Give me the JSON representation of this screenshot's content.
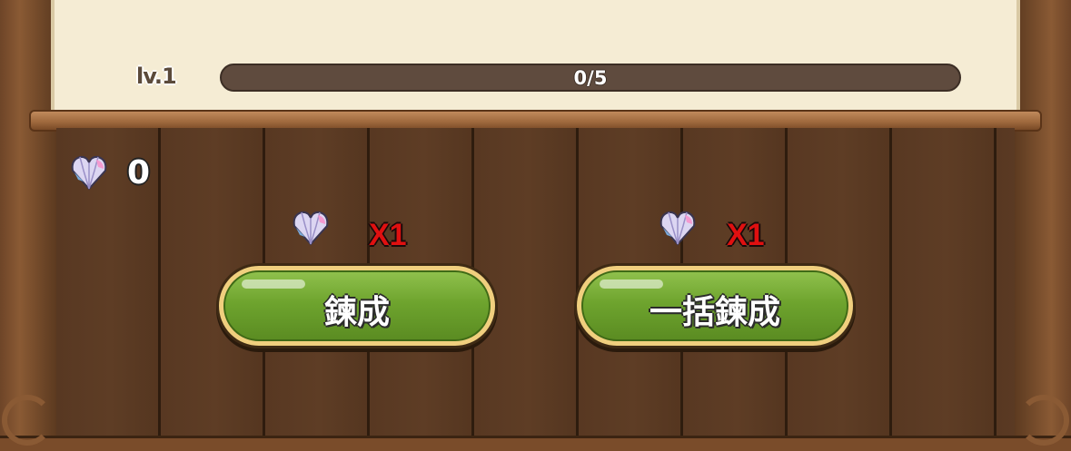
{
  "level": {
    "label": "lv.1",
    "progress_text": "0/5",
    "progress_value": 0,
    "progress_max": 5
  },
  "currency": {
    "icon": "crystal-heart-icon",
    "count": "0"
  },
  "craft": {
    "cost_icon": "crystal-heart-icon",
    "cost_label": "X1",
    "button_label": "鍊成"
  },
  "craft_all": {
    "cost_icon": "crystal-heart-icon",
    "cost_label": "X1",
    "button_label": "一括鍊成"
  },
  "colors": {
    "button_green": "#6ea42e",
    "cost_red": "#e01010",
    "progress_track": "#5f4b3e",
    "parchment": "#f5ecd4"
  }
}
